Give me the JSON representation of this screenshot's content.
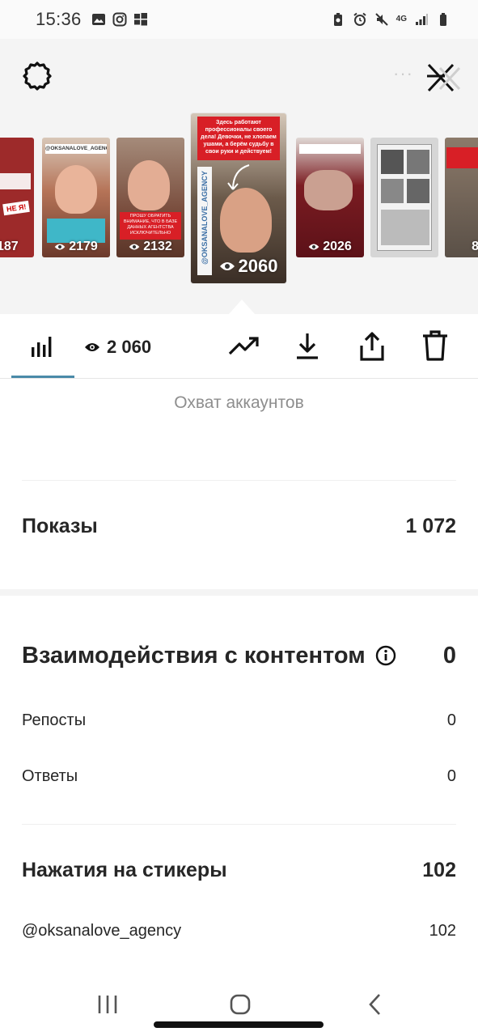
{
  "status_bar": {
    "time": "15:36",
    "network": "4G",
    "left_icons": [
      "gallery-icon",
      "instagram-icon",
      "windows-icon"
    ],
    "right_icons": [
      "recycle-battery-icon",
      "alarm-icon",
      "mute-icon",
      "network-4g-icon",
      "signal-icon",
      "battery-icon"
    ]
  },
  "stories": [
    {
      "views": "187",
      "bg": "#8e1f1f"
    },
    {
      "views": "2179",
      "bg": "#b57357"
    },
    {
      "views": "2132",
      "bg": "#7a4e3e"
    },
    {
      "views": "2060",
      "bg": "#5a4a3e",
      "active": true,
      "top_text": "Здесь работают профессионалы своего дела! Девочки, не хлопаем ушами, а берём судьбу в свои руки и действуем!",
      "side_text": "@OKSANALOVE_AGENCY"
    },
    {
      "views": "2026",
      "bg": "#7b1c22"
    },
    {
      "views": "",
      "bg": "#c9c9c9"
    },
    {
      "views": "8",
      "bg": "#5a5047"
    }
  ],
  "story_labels": {
    "thumb1_badge": "НЕ Я!",
    "thumb2_handle": "@OKSANALOVE_AGENCY",
    "thumb3_text": "ПРОШУ ОБРАТИТЬ ВНИМАНИЕ, ЧТО В БАЗЕ ДАННЫХ АГЕНТСТВА ИСКЛЮЧИТЕЛЬНО"
  },
  "toolbar": {
    "view_count": "2 060",
    "icons": [
      "bar-chart-icon",
      "eye-icon",
      "trending-icon",
      "download-icon",
      "share-icon",
      "trash-icon"
    ]
  },
  "metrics": {
    "reach_label": "Охват аккаунтов",
    "impressions_label": "Показы",
    "impressions_value": "1 072",
    "interactions_label": "Взаимодействия с контентом",
    "interactions_value": "0",
    "reposts_label": "Репосты",
    "reposts_value": "0",
    "replies_label": "Ответы",
    "replies_value": "0",
    "sticker_taps_label": "Нажатия на стикеры",
    "sticker_taps_value": "102",
    "sticker_handle": "@oksanalove_agency",
    "sticker_handle_value": "102"
  },
  "colors": {
    "accent_underline": "#4a8aa8",
    "text_primary": "#262626",
    "text_secondary": "#8e8e8e"
  }
}
